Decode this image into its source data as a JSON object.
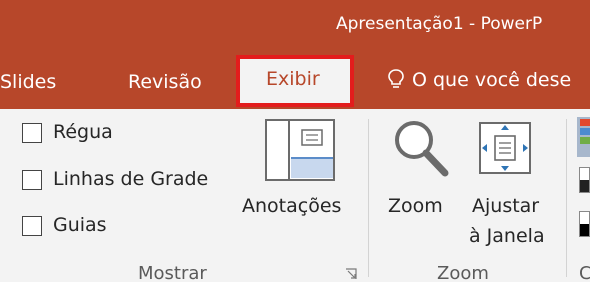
{
  "window": {
    "title": "Apresentação1 - PowerP"
  },
  "tabs": {
    "slides": "Slides",
    "revisao": "Revisão",
    "exibir": "Exibir"
  },
  "tell_me": {
    "text": "O que você dese",
    "icon": "lightbulb-icon"
  },
  "ribbon": {
    "show_group": {
      "label": "Mostrar",
      "checkboxes": [
        {
          "label": "Régua",
          "checked": false
        },
        {
          "label": "Linhas de Grade",
          "checked": false
        },
        {
          "label": "Guias",
          "checked": false
        }
      ]
    },
    "notes_button": {
      "label": "Anotações",
      "icon": "notes-page-icon"
    },
    "zoom_group": {
      "label": "Zoom",
      "zoom_button": {
        "label": "Zoom",
        "icon": "magnifier-icon"
      },
      "fit_window_button": {
        "label_line1": "Ajustar",
        "label_line2": "à Janela",
        "icon": "fit-to-window-icon"
      }
    },
    "color_group": {
      "label_partial": "C"
    }
  },
  "colors": {
    "accent": "#b7472a",
    "highlight_border": "#e31c1c",
    "ribbon_bg": "#f3f3f3"
  }
}
